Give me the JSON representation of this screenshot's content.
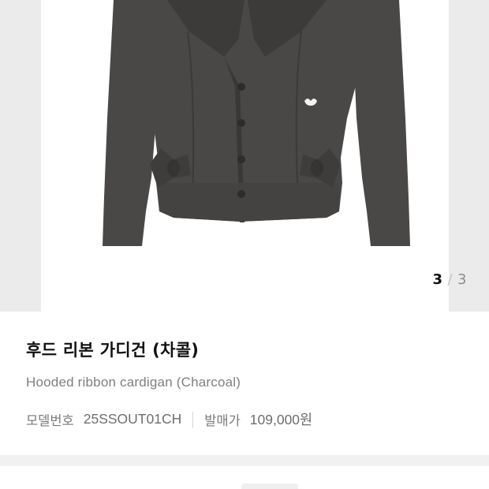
{
  "gallery": {
    "image_icon": "charcoal-hooded-ribbon-cardigan-photo",
    "counter": {
      "current": "3",
      "separator": "/",
      "total": "3"
    }
  },
  "product": {
    "title_ko": "후드 리본 가디건 (차콜)",
    "title_en": "Hooded ribbon cardigan (Charcoal)",
    "model_label": "모델번호",
    "model_number": "25SSOUT01CH",
    "price_label": "발매가",
    "release_price": "109,000원"
  },
  "colors": {
    "garment": "#4a4846",
    "garment_shadow": "#3a3836",
    "gallery_bg": "#ebebeb",
    "section_gap": "#f1f1f1"
  }
}
